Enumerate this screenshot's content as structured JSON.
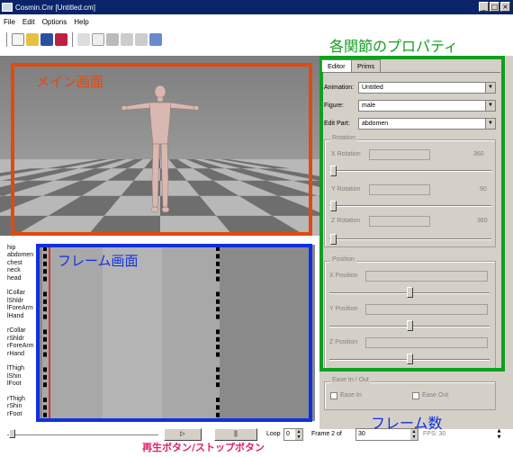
{
  "window": {
    "title": "Cosmin.Cnr [Untitled.cm]"
  },
  "menu": [
    "File",
    "Edit",
    "Options",
    "Help"
  ],
  "annotations": {
    "props": "各関節のプロパティ",
    "main": "メイン画面",
    "frames": "フレーム画面",
    "framecount": "フレーム数",
    "playstop": "再生ボタン/ストップボタン"
  },
  "tracks": [
    "hip",
    "abdomen",
    "chest",
    "neck",
    "head",
    "",
    "lCollar",
    "lShldr",
    "lForeArm",
    "lHand",
    "",
    "rCollar",
    "rShldr",
    "rForeArm",
    "rHand",
    "",
    "lThigh",
    "lShin",
    "lFoot",
    "",
    "rThigh",
    "rShin",
    "rFoot"
  ],
  "props": {
    "tabs": [
      "Editor",
      "Prims"
    ],
    "rows": [
      {
        "label": "Animation:",
        "value": "Untitled"
      },
      {
        "label": "Figure:",
        "value": "male"
      },
      {
        "label": "Edit Part:",
        "value": "abdomen"
      }
    ],
    "rotation": {
      "title": "Rotation",
      "x": {
        "label": "X Rotation",
        "max": "360"
      },
      "y": {
        "label": "Y Rotation",
        "max": "90"
      },
      "z": {
        "label": "Z Rotation",
        "max": "360"
      }
    },
    "position": {
      "title": "Position",
      "x": "X Position",
      "y": "Y Position",
      "z": "Z Position"
    },
    "ease": {
      "title": "Ease In / Out",
      "in": "Ease In",
      "out": "Ease Out"
    }
  },
  "bottom": {
    "play": "▷",
    "stop": "||",
    "loop_label": "Loop",
    "loop_value": "0",
    "frame_label": "Frame 2 of",
    "frame_value": "30",
    "fps_label": "FPS: 30"
  },
  "colors": {
    "red": "#e04a10",
    "blue": "#1030e0",
    "green": "#10a020",
    "pink": "#e0206a"
  }
}
